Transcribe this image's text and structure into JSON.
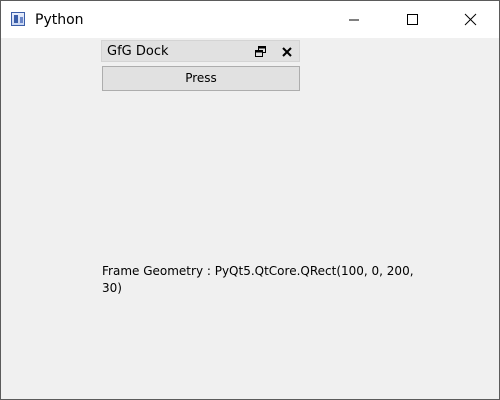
{
  "window": {
    "title": "Python",
    "app_icon": "python-app-icon",
    "controls": {
      "minimize_icon": "minimize-icon",
      "maximize_icon": "maximize-icon",
      "close_icon": "close-icon"
    }
  },
  "dock": {
    "title": "GfG Dock",
    "float_icon": "float-icon",
    "close_icon": "close-icon",
    "button_label": "Press"
  },
  "label": {
    "text": "Frame Geometry : PyQt5.QtCore.QRect(100, 0, 200, 30)"
  },
  "colors": {
    "window_bg": "#f0f0f0",
    "titlebar_bg": "#ffffff",
    "dock_title_bg": "#e1e1e1",
    "button_bg": "#e1e1e1",
    "button_border": "#adadad"
  }
}
